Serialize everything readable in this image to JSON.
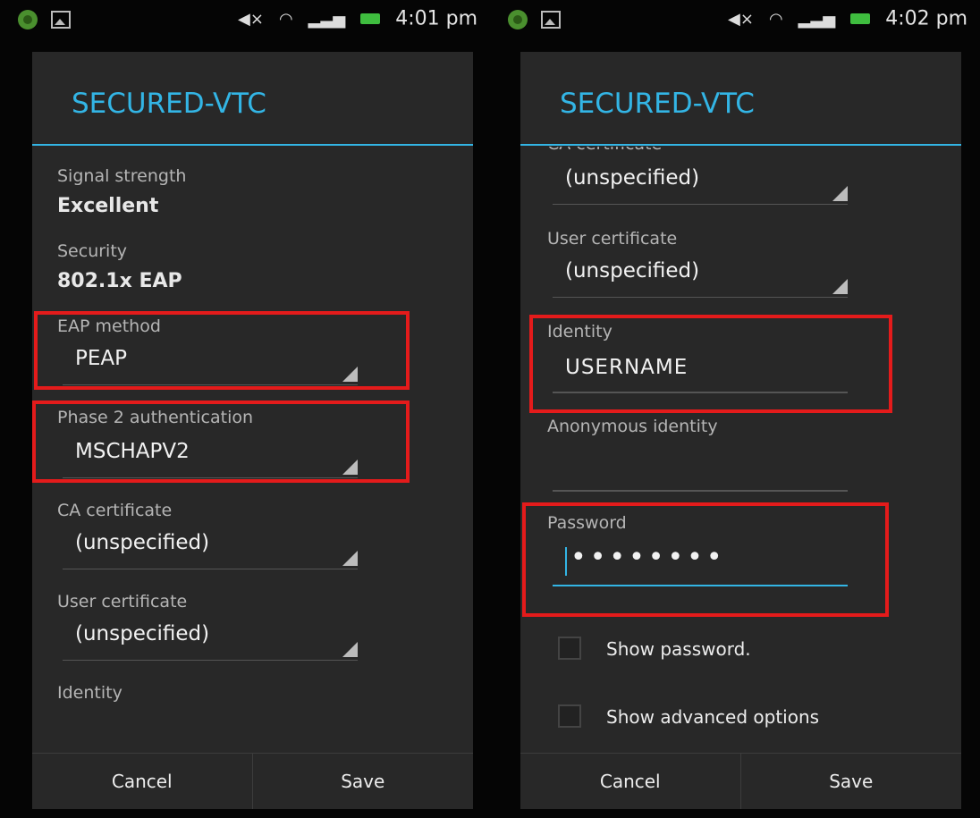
{
  "accent_color": "#33b5e5",
  "highlight_color": "#e41b1b",
  "left": {
    "status": {
      "time": "4:01 pm"
    },
    "title": "SECURED-VTC",
    "signal_label": "Signal strength",
    "signal_value": "Excellent",
    "security_label": "Security",
    "security_value": "802.1x EAP",
    "eap_label": "EAP method",
    "eap_value": "PEAP",
    "phase2_label": "Phase 2 authentication",
    "phase2_value": "MSCHAPV2",
    "ca_label": "CA certificate",
    "ca_value": "(unspecified)",
    "user_cert_label": "User certificate",
    "user_cert_value": "(unspecified)",
    "identity_label": "Identity",
    "cancel": "Cancel",
    "save": "Save"
  },
  "right": {
    "status": {
      "time": "4:02 pm"
    },
    "title": "SECURED-VTC",
    "ca_label_partial": "CA certificate",
    "ca_value": "(unspecified)",
    "user_cert_label": "User certificate",
    "user_cert_value": "(unspecified)",
    "identity_label": "Identity",
    "identity_value": "USERNAME",
    "anon_label": "Anonymous identity",
    "anon_value": "",
    "password_label": "Password",
    "password_value": "••••••••",
    "show_password": "Show password.",
    "show_advanced": "Show advanced options",
    "cancel": "Cancel",
    "save": "Save"
  },
  "icons": [
    "android-icon",
    "image-icon",
    "mute-icon",
    "wifi-icon",
    "signal-icon",
    "battery-icon"
  ]
}
